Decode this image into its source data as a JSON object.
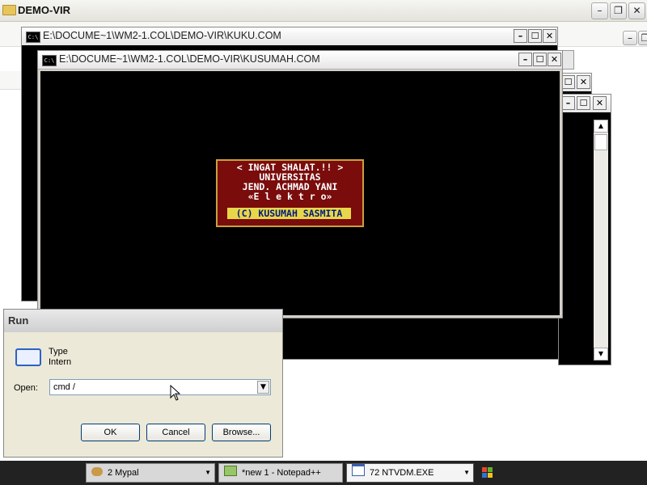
{
  "explorer": {
    "title": "DEMO-VIR",
    "min": "–",
    "max": "❐",
    "close": "✕"
  },
  "console_back": {
    "title": "E:\\DOCUME~1\\WM2-1.COL\\DEMO-VIR\\KUKU.COM",
    "icon": "C:\\"
  },
  "console_front": {
    "title": "E:\\DOCUME~1\\WM2-1.COL\\DEMO-VIR\\KUSUMAH.COM",
    "icon": "C:\\"
  },
  "window_buttons": {
    "min": "–",
    "max": "☐",
    "close": "✕"
  },
  "banner": {
    "line1": "< INGAT SHALAT.!! >",
    "line2": "UNIVERSITAS",
    "line3": "JEND. ACHMAD YANI",
    "line4": "«E l e k t r o»",
    "credit": "(C) KUSUMAH SASMITA"
  },
  "run_dialog": {
    "title": "Run",
    "desc_line1": "Type",
    "desc_line2": "Intern",
    "open_label": "Open:",
    "open_value": "cmd /",
    "ok": "OK",
    "cancel": "Cancel",
    "browse": "Browse..."
  },
  "taskbar": {
    "items": [
      {
        "label": "2 Mypal"
      },
      {
        "label": "*new 1 - Notepad++"
      },
      {
        "label": "72 NTVDM.EXE"
      }
    ]
  },
  "colors": {
    "banner_bg": "#7a0c0c",
    "banner_border": "#c9a13a",
    "credit_bg": "#e8d64a",
    "credit_text": "#001a80"
  }
}
